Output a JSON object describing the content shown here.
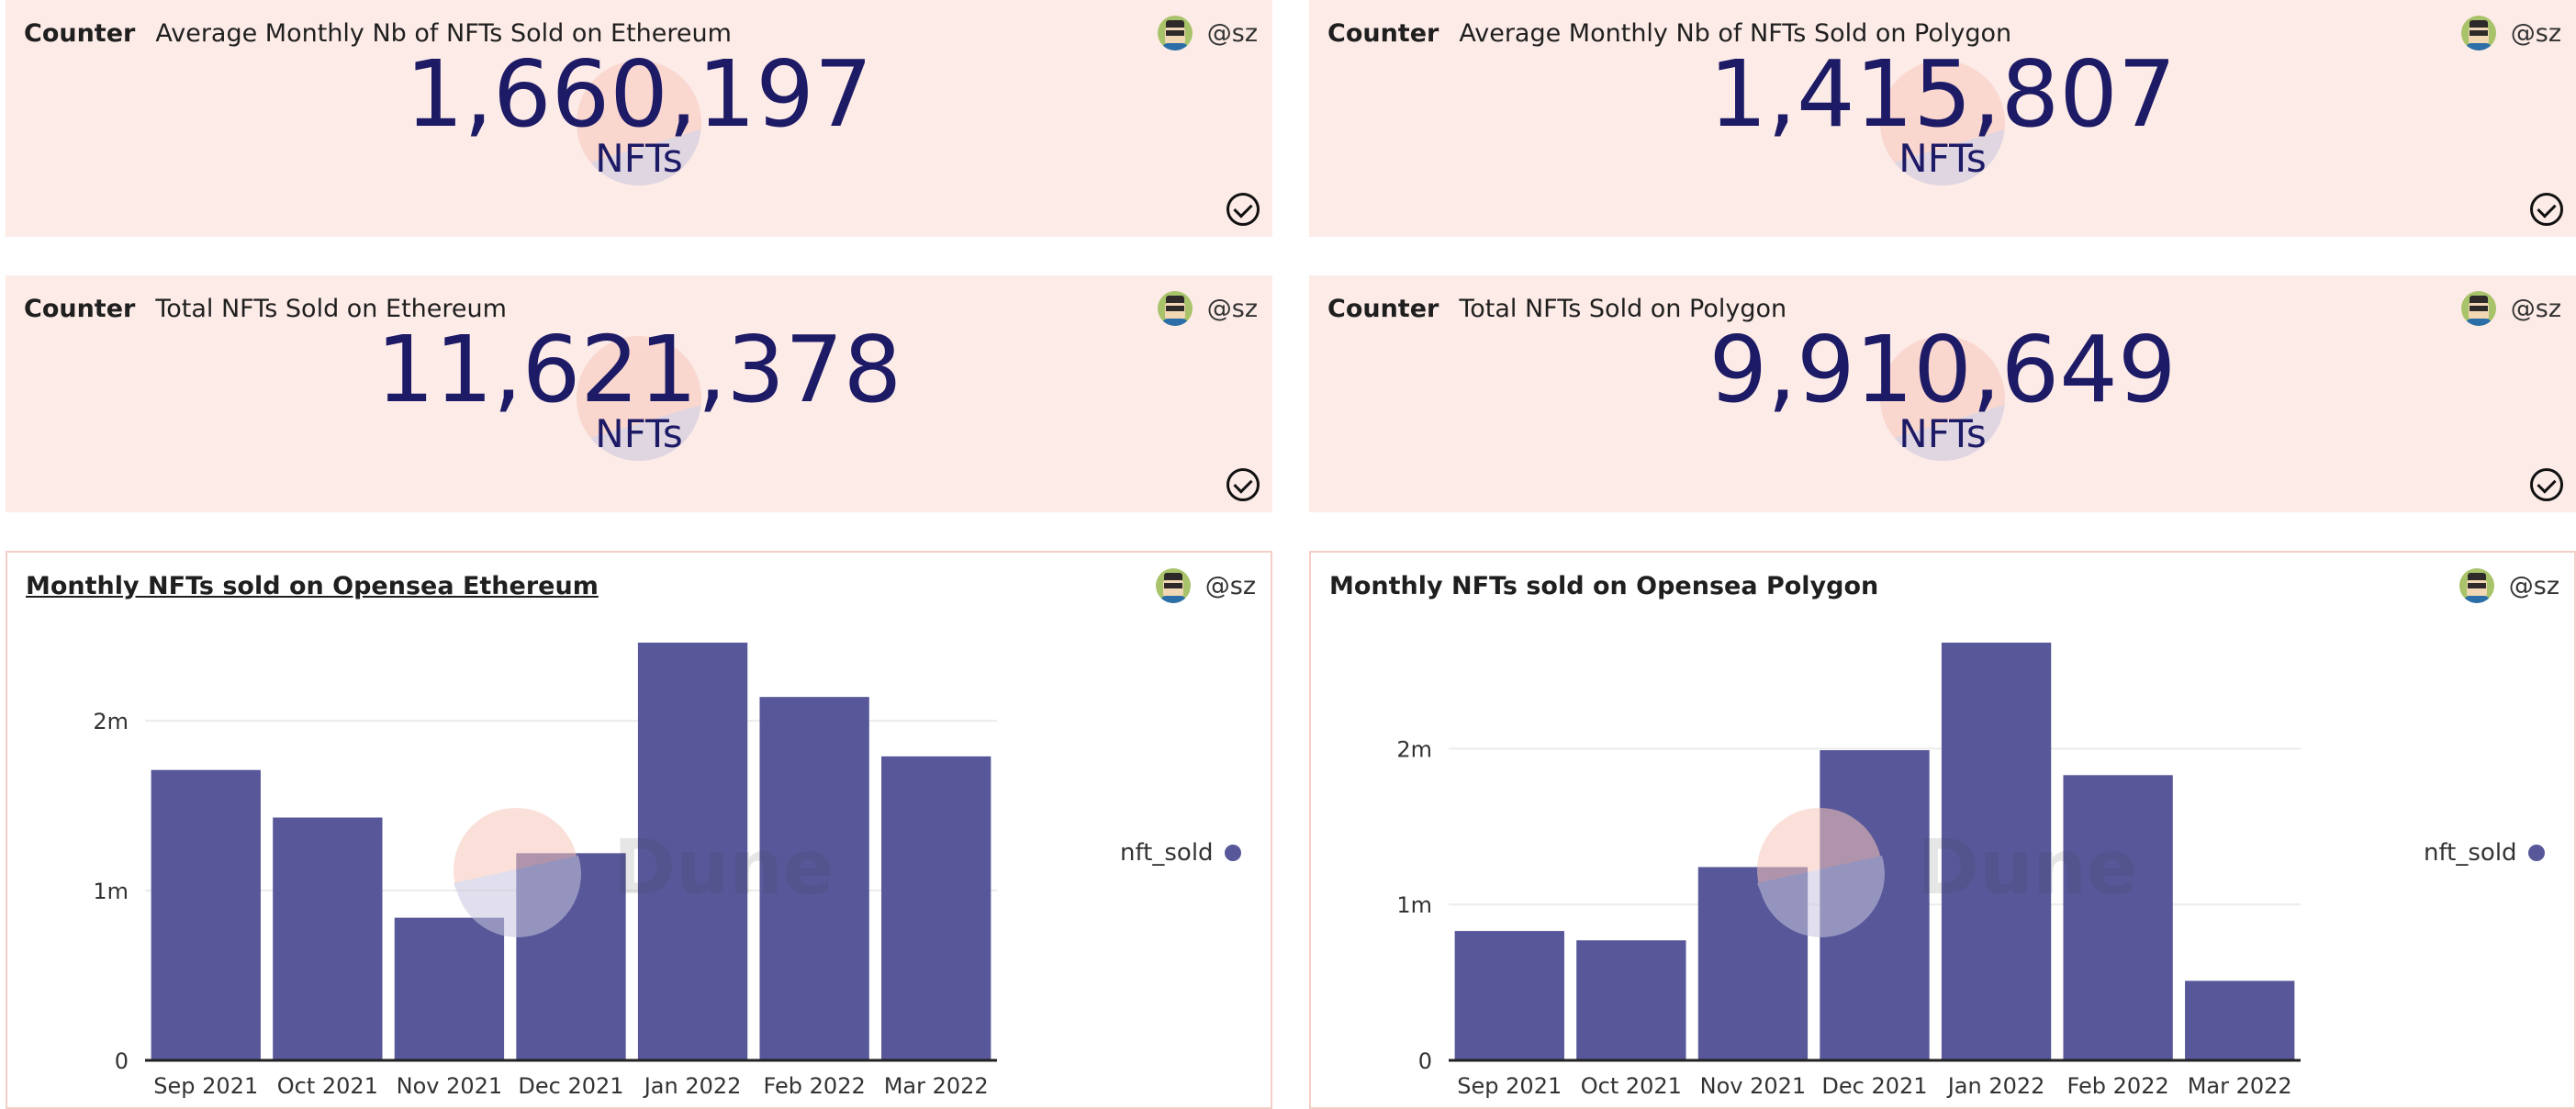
{
  "user": {
    "handle": "@sz"
  },
  "colors": {
    "panel_bg": "#fcebe7",
    "number": "#1d1a66",
    "bar": "#575799"
  },
  "icons": {
    "status": "check-circle-icon",
    "avatar": "user-avatar-icon"
  },
  "watermark": {
    "text": "Dune"
  },
  "counters": [
    {
      "type_label": "Counter",
      "title": "Average Monthly Nb of NFTs Sold on Ethereum",
      "value": "1,660,197",
      "unit": "NFTs"
    },
    {
      "type_label": "Counter",
      "title": "Average Monthly Nb of NFTs Sold on Polygon",
      "value": "1,415,807",
      "unit": "NFTs"
    },
    {
      "type_label": "Counter",
      "title": "Total NFTs Sold on Ethereum",
      "value": "11,621,378",
      "unit": "NFTs"
    },
    {
      "type_label": "Counter",
      "title": "Total NFTs Sold on Polygon",
      "value": "9,910,649",
      "unit": "NFTs"
    }
  ],
  "chart_data": [
    {
      "type": "bar",
      "title": "Monthly NFTs sold on Opensea Ethereum",
      "categories": [
        "Sep 2021",
        "Oct 2021",
        "Nov 2021",
        "Dec 2021",
        "Jan 2022",
        "Feb 2022",
        "Mar 2022"
      ],
      "series": [
        {
          "name": "nft_sold",
          "values": [
            1710000,
            1430000,
            840000,
            1220000,
            2460000,
            2140000,
            1790000
          ]
        }
      ],
      "ylim": [
        0,
        2460000
      ],
      "yticks": [
        0,
        1000000,
        2000000
      ],
      "ytick_labels": [
        "0",
        "1m",
        "2m"
      ],
      "grid": true,
      "legend": "right"
    },
    {
      "type": "bar",
      "title": "Monthly NFTs sold on Opensea Polygon",
      "categories": [
        "Sep 2021",
        "Oct 2021",
        "Nov 2021",
        "Dec 2021",
        "Jan 2022",
        "Feb 2022",
        "Mar 2022"
      ],
      "series": [
        {
          "name": "nft_sold",
          "values": [
            830000,
            770000,
            1240000,
            1990000,
            2680000,
            1830000,
            510000
          ]
        }
      ],
      "ylim": [
        0,
        2680000
      ],
      "yticks": [
        0,
        1000000,
        2000000
      ],
      "ytick_labels": [
        "0",
        "1m",
        "2m"
      ],
      "grid": true,
      "legend": "right"
    }
  ]
}
